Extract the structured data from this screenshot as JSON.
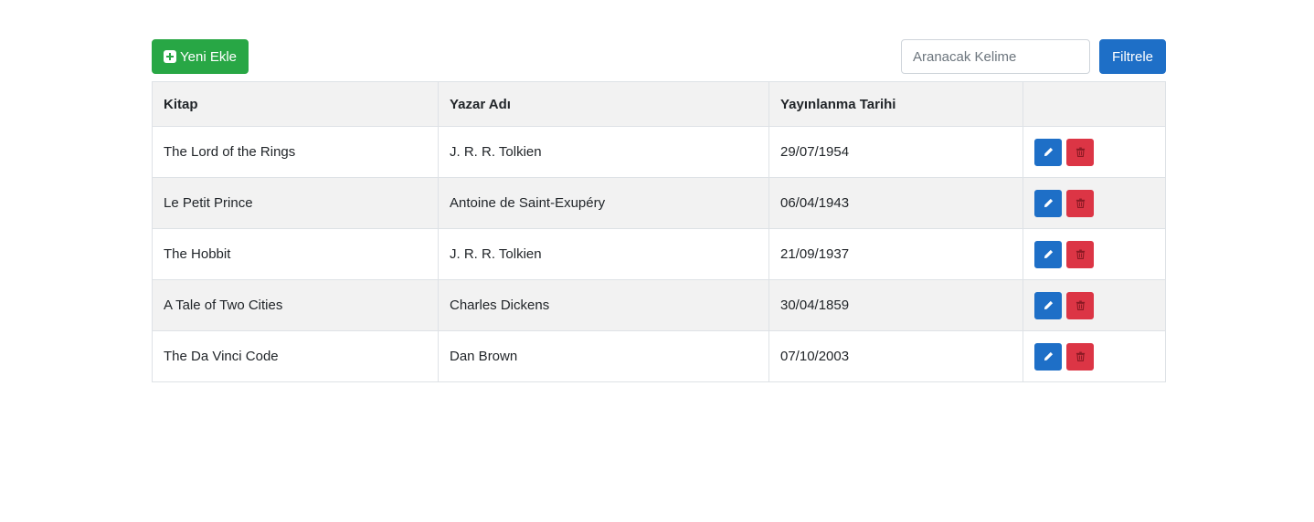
{
  "toolbar": {
    "add_label": "Yeni Ekle",
    "add_icon": "plus-square-icon",
    "search_placeholder": "Aranacak Kelime",
    "search_value": "",
    "filter_label": "Filtrele"
  },
  "table": {
    "headers": [
      "Kitap",
      "Yazar Adı",
      "Yayınlanma Tarihi",
      ""
    ],
    "rows": [
      {
        "book": "The Lord of the Rings",
        "author": "J. R. R. Tolkien",
        "date": "29/07/1954"
      },
      {
        "book": "Le Petit Prince",
        "author": "Antoine de Saint-Exupéry",
        "date": "06/04/1943"
      },
      {
        "book": "The Hobbit",
        "author": "J. R. R. Tolkien",
        "date": "21/09/1937"
      },
      {
        "book": "A Tale of Two Cities",
        "author": "Charles Dickens",
        "date": "30/04/1859"
      },
      {
        "book": "The Da Vinci Code",
        "author": "Dan Brown",
        "date": "07/10/2003"
      }
    ],
    "row_actions": {
      "edit_icon": "pencil-icon",
      "delete_icon": "trash-icon"
    }
  },
  "colors": {
    "add": "#28a745",
    "primary": "#1e6fc7",
    "danger": "#dc3545",
    "stripe": "#f2f2f2"
  }
}
